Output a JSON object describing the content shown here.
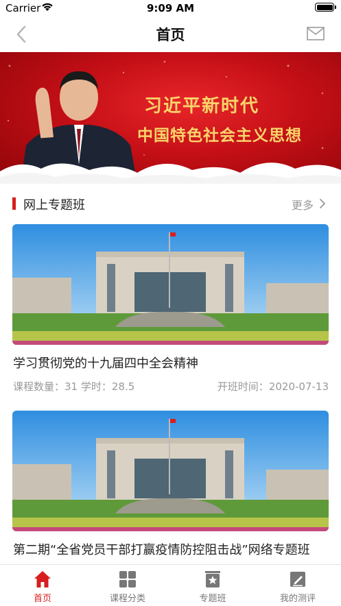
{
  "status_bar": {
    "carrier": "Carrier",
    "time": "9:09 AM"
  },
  "nav": {
    "title": "首页",
    "back_icon": "chevron-left-icon",
    "mail_icon": "mail-icon"
  },
  "banner": {
    "line1": "习近平新时代",
    "line2": "中国特色社会主义思想"
  },
  "section": {
    "title": "网上专题班",
    "more": "更多"
  },
  "courses": [
    {
      "title": "学习贯彻党的十九届四中全会精神",
      "count_label": "课程数量：",
      "count": "31",
      "hours_label": "学时：",
      "hours": "28.5",
      "date_label": "开班时间：",
      "date": "2020-07-13"
    },
    {
      "title": "第二期“全省党员干部打赢疫情防控阻击战”网络专题班"
    }
  ],
  "tabs": [
    {
      "label": "首页",
      "icon": "home-icon",
      "active": true
    },
    {
      "label": "课程分类",
      "icon": "grid-icon",
      "active": false
    },
    {
      "label": "专题班",
      "icon": "star-board-icon",
      "active": false
    },
    {
      "label": "我的测评",
      "icon": "edit-note-icon",
      "active": false
    }
  ],
  "colors": {
    "accent": "#d81e1e",
    "banner_red": "#c40f16",
    "banner_gold": "#f8d56a",
    "muted": "#999999"
  }
}
